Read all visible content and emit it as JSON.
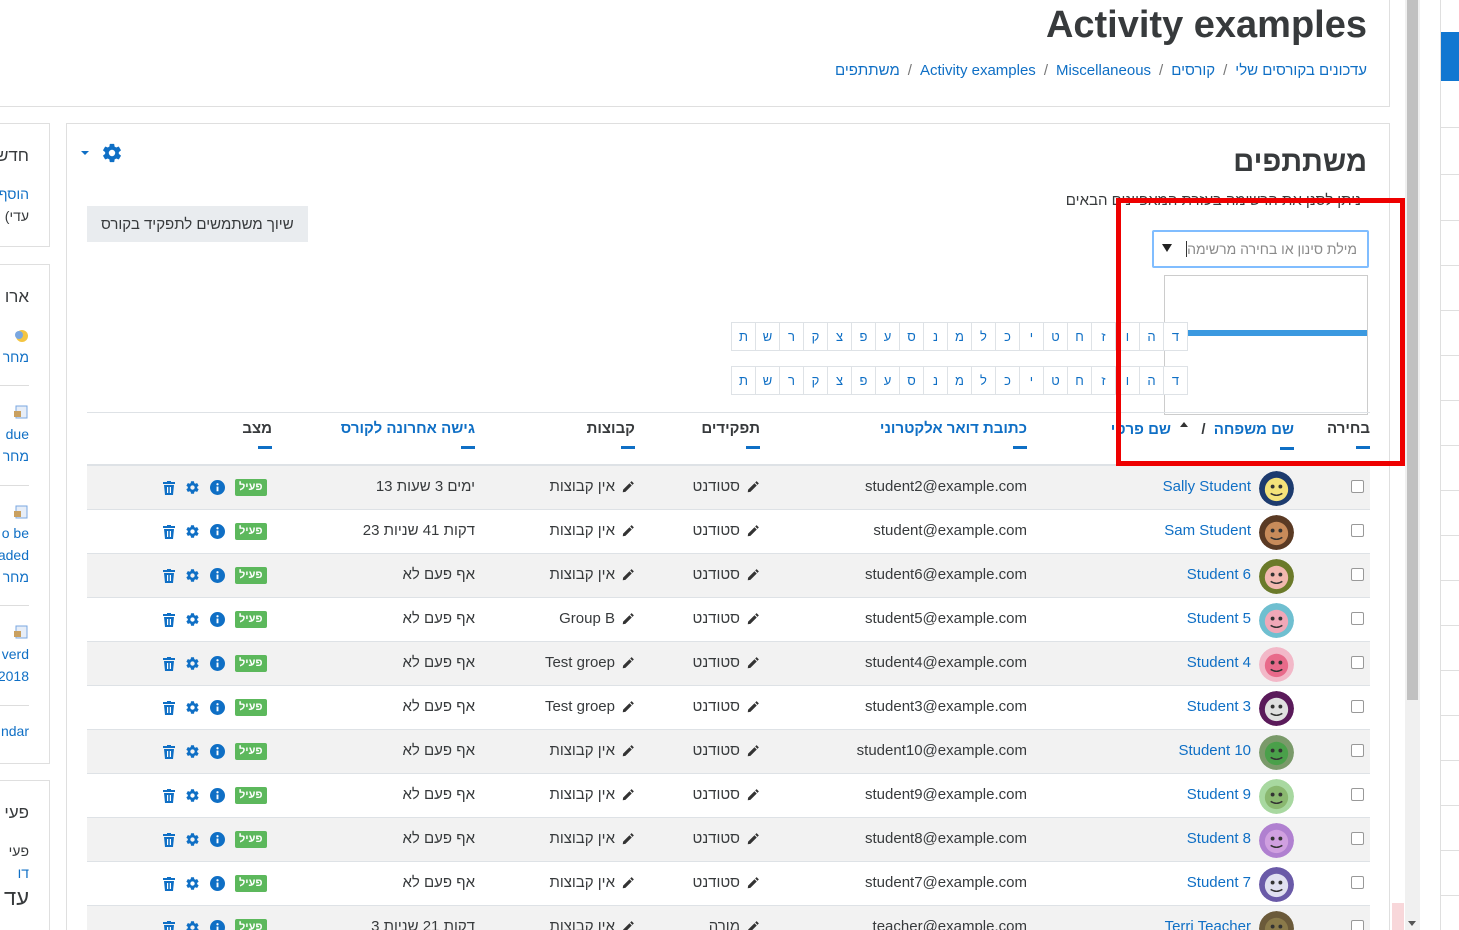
{
  "header": {
    "title": "Activity examples",
    "breadcrumb": [
      "עדכונים בקורסים שלי",
      "קורסים",
      "Miscellaneous",
      "Activity examples",
      "משתתפים"
    ]
  },
  "left_blocks": {
    "news_title": "חדש",
    "news_link": "הוסף",
    "news_sub": "(עדי",
    "org_title": "ארו",
    "item1": "מחר",
    "item2a": "due",
    "item2b": "מחר",
    "item3a": "o be",
    "item3b": "aded",
    "item3c": "מחר",
    "item4a": "verd",
    "item4b": "2018",
    "calendar": "ndar",
    "activity_title": "פעי",
    "activity_sub": "פעי",
    "activity_link": "דו",
    "bottom": "עד"
  },
  "participants": {
    "title": "משתתפים",
    "intro": "ניתן לסנן את הרשימה בעזרת המאפיינים הבאים",
    "enrol_button": "שיוך משתמשים לתפקיד בקורס",
    "filter_placeholder": "מילת סינון או בחירה מרשימה"
  },
  "initials_row1": [
    "ד",
    "ה",
    "ו",
    "ז",
    "ח",
    "ט",
    "י",
    "כ",
    "ל",
    "מ",
    "נ",
    "ס",
    "ע",
    "פ",
    "צ",
    "ק",
    "ר",
    "ש",
    "ת"
  ],
  "initials_row2": [
    "ד",
    "ה",
    "ו",
    "ז",
    "ח",
    "ט",
    "י",
    "כ",
    "ל",
    "מ",
    "נ",
    "ס",
    "ע",
    "פ",
    "צ",
    "ק",
    "ר",
    "ש",
    "ת"
  ],
  "columns": {
    "select": "בחירה",
    "firstname": "שם פרטי",
    "slash": "/",
    "lastname": "שם משפחה",
    "email": "כתובת דואר אלקטרוני",
    "roles": "תפקידים",
    "groups": "קבוצות",
    "last_access": "גישה אחרונה לקורס",
    "status": "מצב"
  },
  "status_active": "פעיל",
  "rows": [
    {
      "name": "Sally Student",
      "email": "student2@example.com",
      "role": "סטודנט",
      "groups": "אין קבוצות",
      "access": "13 ימים 3 שעות"
    },
    {
      "name": "Sam Student",
      "email": "student@example.com",
      "role": "סטודנט",
      "groups": "אין קבוצות",
      "access": "23 דקות 41 שניות"
    },
    {
      "name": "Student 6",
      "email": "student6@example.com",
      "role": "סטודנט",
      "groups": "אין קבוצות",
      "access": "אף פעם לא"
    },
    {
      "name": "Student 5",
      "email": "student5@example.com",
      "role": "סטודנט",
      "groups": "Group B",
      "access": "אף פעם לא"
    },
    {
      "name": "Student 4",
      "email": "student4@example.com",
      "role": "סטודנט",
      "groups": "Test groep",
      "access": "אף פעם לא"
    },
    {
      "name": "Student 3",
      "email": "student3@example.com",
      "role": "סטודנט",
      "groups": "Test groep",
      "access": "אף פעם לא"
    },
    {
      "name": "Student 10",
      "email": "student10@example.com",
      "role": "סטודנט",
      "groups": "אין קבוצות",
      "access": "אף פעם לא"
    },
    {
      "name": "Student 9",
      "email": "student9@example.com",
      "role": "סטודנט",
      "groups": "אין קבוצות",
      "access": "אף פעם לא"
    },
    {
      "name": "Student 8",
      "email": "student8@example.com",
      "role": "סטודנט",
      "groups": "אין קבוצות",
      "access": "אף פעם לא"
    },
    {
      "name": "Student 7",
      "email": "student7@example.com",
      "role": "סטודנט",
      "groups": "אין קבוצות",
      "access": "אף פעם לא"
    },
    {
      "name": "Terri Teacher",
      "email": "teacher@example.com",
      "role": "מורה",
      "groups": "אין קבוצות",
      "access": "3 דקות 21 שניות"
    }
  ],
  "colors": {
    "link": "#0f6fc5",
    "badge": "#5cb85c",
    "highlight": "#ee0000",
    "focus": "#80bdff"
  },
  "icons": [
    "gear-icon",
    "caret-down-icon",
    "pencil-icon",
    "trash-icon",
    "cog-icon",
    "info-icon",
    "sort-asc-icon",
    "checkbox-icon",
    "avatar"
  ]
}
